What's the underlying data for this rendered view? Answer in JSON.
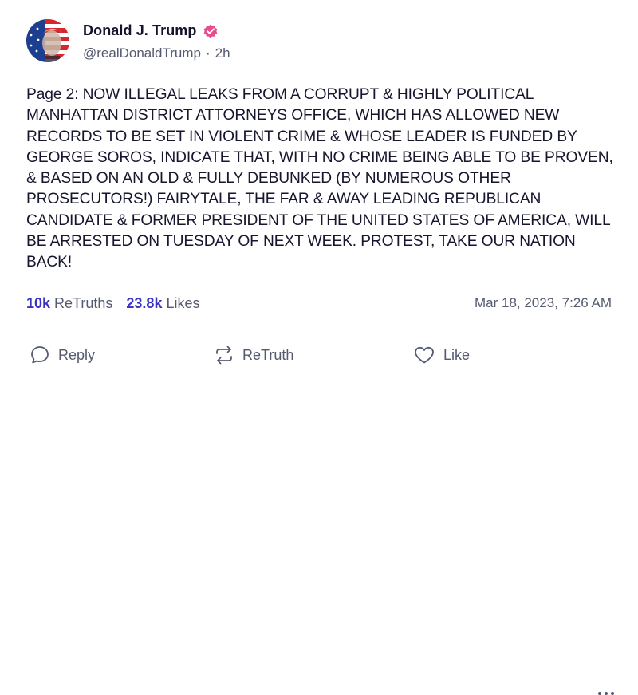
{
  "post": {
    "author": {
      "display_name": "Donald J. Trump",
      "handle": "@realDonaldTrump",
      "age": "2h",
      "verified_color": "#e74c8b"
    },
    "body": "Page 2: NOW ILLEGAL LEAKS FROM A CORRUPT & HIGHLY POLITICAL MANHATTAN DISTRICT ATTORNEYS OFFICE, WHICH HAS ALLOWED NEW RECORDS TO BE SET IN VIOLENT CRIME & WHOSE LEADER IS FUNDED BY GEORGE SOROS, INDICATE THAT, WITH NO CRIME BEING ABLE TO BE PROVEN, & BASED ON AN OLD & FULLY DEBUNKED (BY NUMEROUS OTHER PROSECUTORS!) FAIRYTALE, THE FAR & AWAY LEADING REPUBLICAN CANDIDATE & FORMER PRESIDENT OF THE UNITED STATES OF AMERICA, WILL BE ARRESTED ON TUESDAY OF NEXT WEEK. PROTEST, TAKE OUR NATION BACK!",
    "stats": {
      "retruths_count": "10k",
      "retruths_label": "ReTruths",
      "likes_count": "23.8k",
      "likes_label": "Likes"
    },
    "timestamp": "Mar 18, 2023, 7:26 AM"
  },
  "actions": {
    "reply_label": "Reply",
    "retruth_label": "ReTruth",
    "like_label": "Like"
  },
  "icons": {
    "reply": "speech-bubble-icon",
    "retruth": "repost-arrows-icon",
    "like": "heart-icon",
    "more": "more-dots-icon",
    "verified": "verified-badge-icon"
  },
  "colors": {
    "accent": "#3b33c4",
    "muted_text": "#555a70",
    "body_text": "#16162e"
  }
}
